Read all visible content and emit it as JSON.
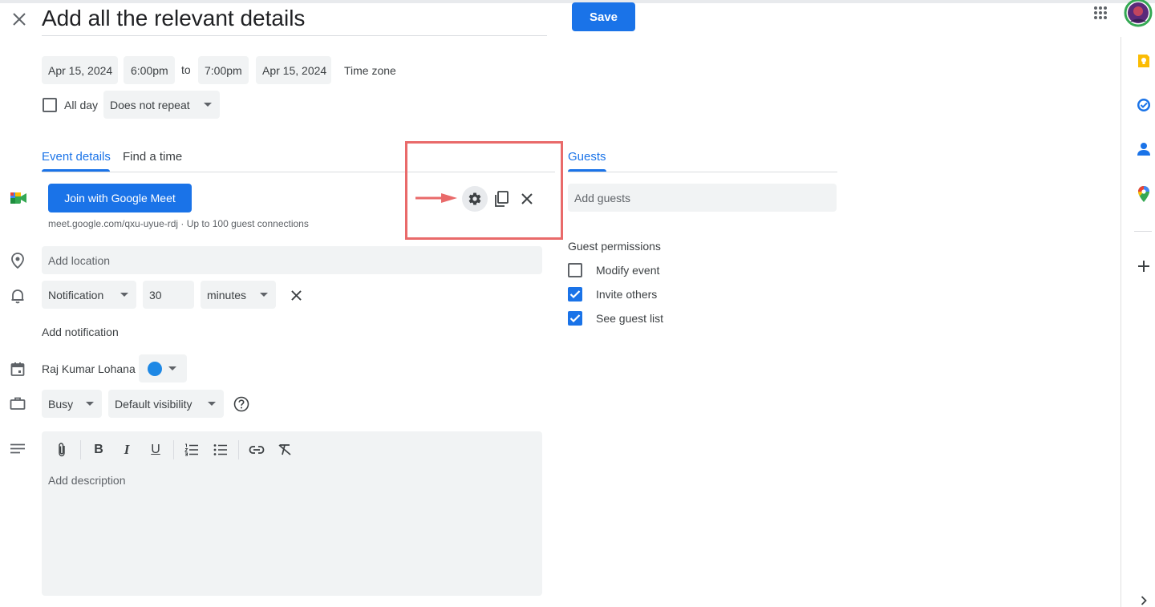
{
  "header": {
    "title": "Add all the relevant details",
    "save_label": "Save"
  },
  "datetime": {
    "start_date": "Apr 15, 2024",
    "start_time": "6:00pm",
    "to": "to",
    "end_time": "7:00pm",
    "end_date": "Apr 15, 2024",
    "time_zone": "Time zone",
    "all_day_label": "All day",
    "all_day_checked": false,
    "repeat": "Does not repeat"
  },
  "tabs": {
    "event_details": "Event details",
    "find_a_time": "Find a time",
    "guests": "Guests"
  },
  "meet": {
    "button_label": "Join with Google Meet",
    "link_text": "meet.google.com/qxu-uyue-rdj · Up to 100 guest connections"
  },
  "location": {
    "placeholder": "Add location"
  },
  "notification": {
    "type": "Notification",
    "value": "30",
    "unit": "minutes",
    "add_label": "Add notification"
  },
  "calendar": {
    "owner": "Raj Kumar Lohana",
    "color": "#1e88e5"
  },
  "availability": {
    "status": "Busy",
    "visibility": "Default visibility"
  },
  "description": {
    "placeholder": "Add description"
  },
  "guests": {
    "placeholder": "Add guests",
    "permissions_title": "Guest permissions",
    "permissions": [
      {
        "label": "Modify event",
        "checked": false
      },
      {
        "label": "Invite others",
        "checked": true
      },
      {
        "label": "See guest list",
        "checked": true
      }
    ]
  },
  "colors": {
    "accent": "#1a73e8",
    "highlight_annotation": "#e96a6a"
  },
  "icons": {
    "close": "close-icon",
    "apps": "apps-grid-icon",
    "settings": "gear-icon",
    "copy": "copy-icon",
    "remove": "close-icon",
    "keep": "keep-icon",
    "tasks": "tasks-icon",
    "contacts": "contacts-icon",
    "maps": "maps-icon",
    "add": "plus-icon"
  }
}
